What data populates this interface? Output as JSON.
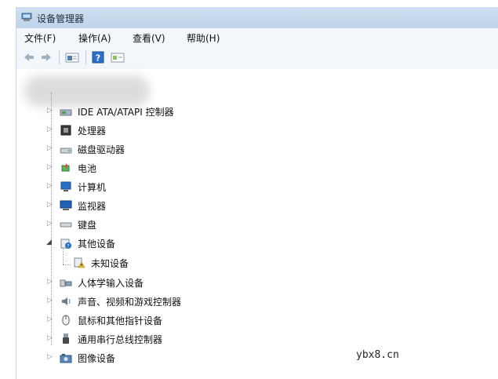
{
  "window": {
    "title": "设备管理器"
  },
  "menu": [
    "文件(F)",
    "操作(A)",
    "查看(V)",
    "帮助(H)"
  ],
  "toolbar": [
    {
      "name": "back",
      "icon": "back-arrow-icon"
    },
    {
      "name": "forward",
      "icon": "forward-arrow-icon"
    },
    {
      "name": "properties",
      "icon": "properties-icon"
    },
    {
      "name": "help",
      "icon": "help-icon"
    },
    {
      "name": "view",
      "icon": "view-icon"
    }
  ],
  "tree": [
    {
      "label": "IDE ATA/ATAPI 控制器",
      "icon": "ide-controller-icon"
    },
    {
      "label": "处理器",
      "icon": "processor-icon"
    },
    {
      "label": "磁盘驱动器",
      "icon": "disk-drive-icon"
    },
    {
      "label": "电池",
      "icon": "battery-icon"
    },
    {
      "label": "计算机",
      "icon": "computer-icon"
    },
    {
      "label": "监视器",
      "icon": "monitor-icon"
    },
    {
      "label": "键盘",
      "icon": "keyboard-icon"
    },
    {
      "label": "其他设备",
      "icon": "other-devices-icon",
      "expanded": true
    },
    {
      "label": "未知设备",
      "icon": "unknown-device-warning-icon",
      "child": true
    },
    {
      "label": "人体学输入设备",
      "icon": "hid-icon"
    },
    {
      "label": "声音、视频和游戏控制器",
      "icon": "sound-icon"
    },
    {
      "label": "鼠标和其他指针设备",
      "icon": "mouse-icon"
    },
    {
      "label": "通用串行总线控制器",
      "icon": "usb-icon"
    },
    {
      "label": "图像设备",
      "icon": "imaging-device-icon"
    }
  ],
  "watermark": "ybx8.cn",
  "colors": {
    "titlebar": "#bcd3ea",
    "accent": "#2a6fc9",
    "warning": "#f0c030"
  }
}
